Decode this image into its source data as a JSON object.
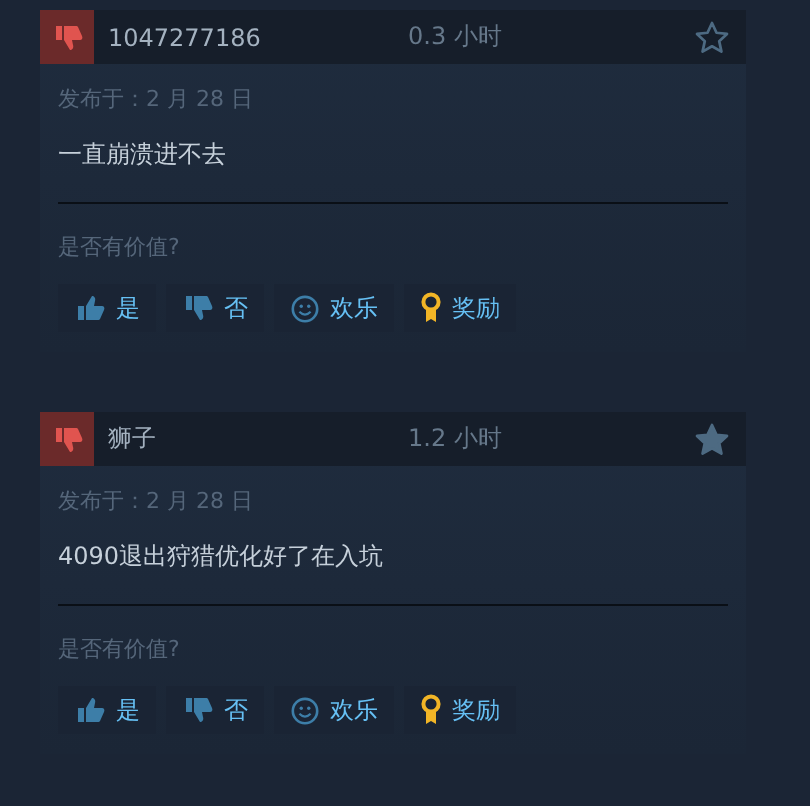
{
  "reviews": [
    {
      "recommended": false,
      "author": "1047277186",
      "hours": "0.3 小时",
      "starred": false,
      "posted": "发布于：2 月 28 日",
      "text": "一直崩溃进不去",
      "helpful_prompt": "是否有价值?",
      "actions": [
        {
          "kind": "yes",
          "label": "是"
        },
        {
          "kind": "no",
          "label": "否"
        },
        {
          "kind": "funny",
          "label": "欢乐"
        },
        {
          "kind": "award",
          "label": "奖励"
        }
      ]
    },
    {
      "recommended": false,
      "author": "狮子",
      "hours": "1.2 小时",
      "starred": true,
      "posted": "发布于：2 月 28 日",
      "text": "4090退出狩猎优化好了在入坑",
      "helpful_prompt": "是否有价值?",
      "actions": [
        {
          "kind": "yes",
          "label": "是"
        },
        {
          "kind": "no",
          "label": "否"
        },
        {
          "kind": "funny",
          "label": "欢乐"
        },
        {
          "kind": "award",
          "label": "奖励"
        }
      ]
    }
  ]
}
